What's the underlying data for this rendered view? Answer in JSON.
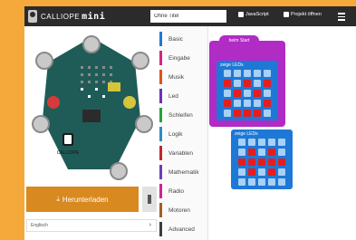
{
  "app": {
    "logo_text": "CALLIOPE",
    "logo_suffix": "mini",
    "title_value": "Ohne Titel",
    "javascript_label": "JavaScript",
    "project_label": "Projekt öffnen"
  },
  "simulator": {
    "board_label": "CALLIOPE",
    "download_label": "Herunterladen",
    "select_value": "Englisch"
  },
  "toolbox": {
    "items": [
      {
        "label": "Basic",
        "color": "#1e78d6"
      },
      {
        "label": "Eingabe",
        "color": "#d6257b"
      },
      {
        "label": "Musik",
        "color": "#e0521e"
      },
      {
        "label": "Led",
        "color": "#6d2fb5"
      },
      {
        "label": "Schleifen",
        "color": "#24a33b"
      },
      {
        "label": "Logik",
        "color": "#2c8dbf"
      },
      {
        "label": "Variablen",
        "color": "#c1272d"
      },
      {
        "label": "Mathematik",
        "color": "#6c3cb8"
      },
      {
        "label": "Radio",
        "color": "#d2238f"
      },
      {
        "label": "Motoren",
        "color": "#a45e24"
      },
      {
        "label": "Advanced",
        "color": "#3b3b3b"
      }
    ]
  },
  "workspace": {
    "start_label": "beim Start",
    "block1": {
      "label": "zeige LEDs",
      "rows": [
        [
          0,
          0,
          0,
          0,
          0
        ],
        [
          1,
          0,
          1,
          0,
          1
        ],
        [
          0,
          1,
          0,
          1,
          0
        ],
        [
          1,
          0,
          0,
          0,
          1
        ],
        [
          0,
          1,
          1,
          1,
          0
        ]
      ]
    },
    "block2": {
      "label": "zeige LEDs",
      "rows": [
        [
          0,
          0,
          0,
          0,
          0
        ],
        [
          0,
          1,
          0,
          1,
          0
        ],
        [
          1,
          1,
          1,
          1,
          1
        ],
        [
          0,
          1,
          0,
          1,
          0
        ],
        [
          0,
          0,
          0,
          0,
          0
        ]
      ]
    }
  },
  "colors": {
    "page_bg": "#f5a93a",
    "topbar": "#2b2b2b",
    "download": "#d8891f",
    "event_block": "#b12bc5",
    "basic_block": "#1e78d6",
    "led_on": "#e51d1d",
    "led_off": "#a9d0f5"
  }
}
